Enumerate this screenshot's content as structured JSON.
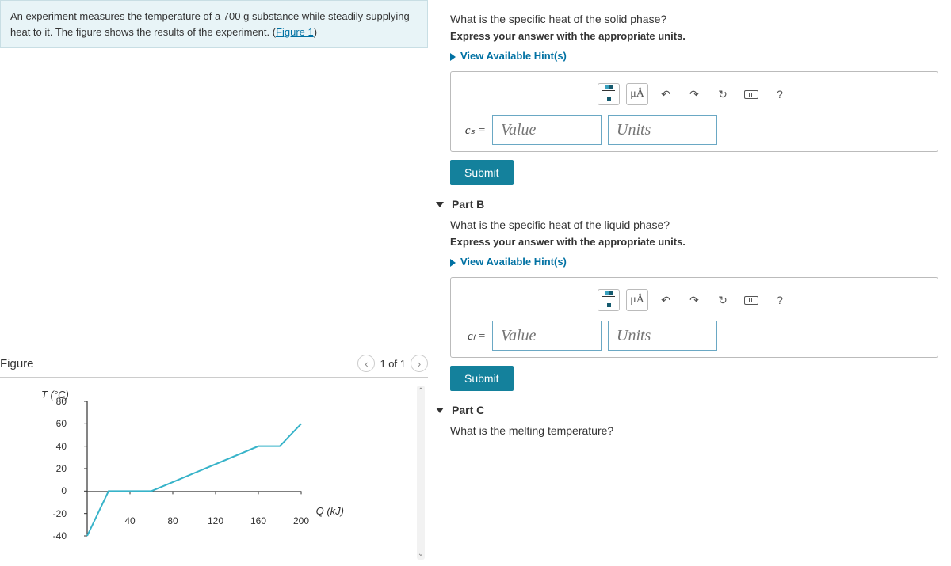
{
  "problem": {
    "intro_pre": "An experiment measures the temperature of a 700 g substance while steadily supplying heat to it. The figure shows the results of the experiment. (",
    "intro_link": "Figure 1",
    "intro_post": ")"
  },
  "figure": {
    "title": "Figure",
    "pager": "1 of 1"
  },
  "chart_data": {
    "type": "line",
    "xlabel": "Q (kJ)",
    "ylabel": "T (°C)",
    "xlim": [
      0,
      200
    ],
    "ylim": [
      -40,
      80
    ],
    "xticks": [
      40,
      80,
      120,
      160,
      200
    ],
    "yticks": [
      -40,
      -20,
      0,
      20,
      40,
      60,
      80
    ],
    "series": [
      {
        "name": "T",
        "points": [
          [
            0,
            -40
          ],
          [
            20,
            0
          ],
          [
            60,
            0
          ],
          [
            160,
            40
          ],
          [
            180,
            40
          ],
          [
            200,
            60
          ]
        ]
      }
    ]
  },
  "parts": {
    "a": {
      "question": "What is the specific heat of the solid phase?",
      "instruction": "Express your answer with the appropriate units.",
      "hints": "View Available Hint(s)",
      "var": "cₛ =",
      "value_ph": "Value",
      "units_ph": "Units",
      "submit": "Submit"
    },
    "b": {
      "label": "Part B",
      "question": "What is the specific heat of the liquid phase?",
      "instruction": "Express your answer with the appropriate units.",
      "hints": "View Available Hint(s)",
      "var": "cₗ =",
      "value_ph": "Value",
      "units_ph": "Units",
      "submit": "Submit"
    },
    "c": {
      "label": "Part C",
      "question": "What is the melting temperature?"
    }
  },
  "toolbar": {
    "mua": "μÅ",
    "undo": "↶",
    "redo": "↷",
    "reset": "↻",
    "help": "?"
  }
}
